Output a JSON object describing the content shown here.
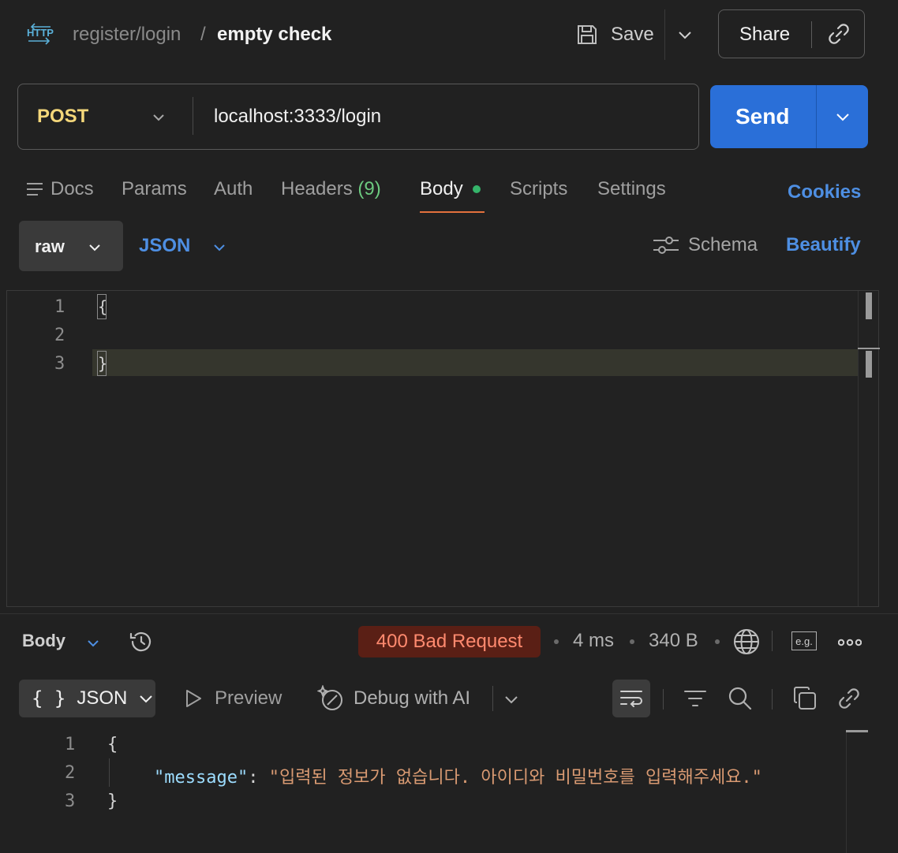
{
  "header": {
    "request_type_icon": "http-icon",
    "breadcrumb_parent": "register/login",
    "breadcrumb_separator": "/",
    "breadcrumb_current": "empty check",
    "save_label": "Save",
    "share_label": "Share"
  },
  "request": {
    "method": "POST",
    "url": "localhost:3333/login",
    "send_label": "Send"
  },
  "tabs": {
    "docs": "Docs",
    "params": "Params",
    "auth": "Auth",
    "headers": "Headers",
    "headers_count": "(9)",
    "body": "Body",
    "scripts": "Scripts",
    "settings": "Settings",
    "cookies": "Cookies",
    "active": "Body"
  },
  "body_options": {
    "mode": "raw",
    "language": "JSON",
    "schema_label": "Schema",
    "beautify_label": "Beautify"
  },
  "editor": {
    "line_numbers": [
      "1",
      "2",
      "3"
    ],
    "lines": [
      "{",
      "",
      "}"
    ]
  },
  "response": {
    "section_label": "Body",
    "status": "400 Bad Request",
    "time": "4 ms",
    "size": "340 B",
    "example_label": "e.g.",
    "format_label": "JSON",
    "format_braces": "{ }",
    "preview_label": "Preview",
    "debug_label": "Debug with AI",
    "line_numbers": [
      "1",
      "2",
      "3"
    ],
    "open_brace": "{",
    "close_brace": "}",
    "key": "\"message\"",
    "colon": ": ",
    "value": "\"입력된 정보가 없습니다. 아이디와 비밀번호를 입력해주세요.\""
  },
  "colors": {
    "accent_blue": "#4e8fe3",
    "send_button": "#2a6fd8",
    "method_post": "#f4d77a",
    "status_error_bg": "#5a1f15",
    "status_error_text": "#ff8a6f",
    "active_tab_underline": "#e3713d",
    "body_dot": "#35b46a"
  }
}
